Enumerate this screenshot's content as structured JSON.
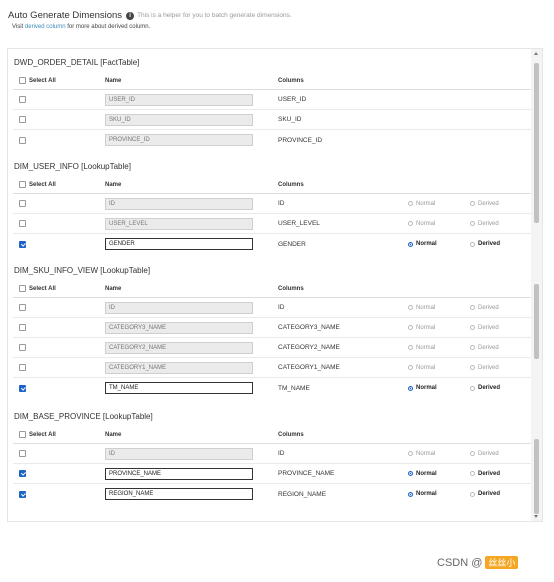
{
  "header": {
    "title": "Auto Generate Dimensions",
    "info_icon": "info-circle-icon",
    "helper": "This is a helper for you to batch generate dimensions.",
    "visit_prefix": "Visit",
    "link_text": "derived column",
    "visit_suffix": "for more about derived column."
  },
  "columns_header": {
    "select_all": "Select All",
    "name": "Name",
    "columns": "Columns"
  },
  "sections": [
    {
      "title": "DWD_ORDER_DETAIL [FactTable]",
      "rows": [
        {
          "checked": false,
          "name": "USER_ID",
          "column": "USER_ID",
          "editable": true
        },
        {
          "checked": false,
          "name": "SKU_ID",
          "column": "SKU_ID",
          "editable": false
        },
        {
          "checked": false,
          "name": "PROVINCE_ID",
          "column": "PROVINCE_ID",
          "editable": true
        }
      ]
    },
    {
      "title": "DIM_USER_INFO [LookupTable]",
      "rows": [
        {
          "checked": false,
          "name": "ID",
          "column": "ID",
          "editable": false,
          "normal": "Normal",
          "derived": "Derived",
          "type": "none"
        },
        {
          "checked": false,
          "name": "USER_LEVEL",
          "column": "USER_LEVEL",
          "editable": false,
          "normal": "Normal",
          "derived": "Derived",
          "type": "none"
        },
        {
          "checked": true,
          "name": "GENDER",
          "column": "GENDER",
          "editable": true,
          "normal": "Normal",
          "derived": "Derived",
          "type": "normal"
        }
      ]
    },
    {
      "title": "DIM_SKU_INFO_VIEW [LookupTable]",
      "rows": [
        {
          "checked": false,
          "name": "ID",
          "column": "ID",
          "editable": false,
          "normal": "Normal",
          "derived": "Derived",
          "type": "none"
        },
        {
          "checked": false,
          "name": "CATEGORY3_NAME",
          "column": "CATEGORY3_NAME",
          "editable": false,
          "normal": "Normal",
          "derived": "Derived",
          "type": "none"
        },
        {
          "checked": false,
          "name": "CATEGORY2_NAME",
          "column": "CATEGORY2_NAME",
          "editable": false,
          "normal": "Normal",
          "derived": "Derived",
          "type": "none"
        },
        {
          "checked": false,
          "name": "CATEGORY1_NAME",
          "column": "CATEGORY1_NAME",
          "editable": false,
          "normal": "Normal",
          "derived": "Derived",
          "type": "none"
        },
        {
          "checked": true,
          "name": "TM_NAME",
          "column": "TM_NAME",
          "editable": true,
          "normal": "Normal",
          "derived": "Derived",
          "type": "normal"
        }
      ]
    },
    {
      "title": "DIM_BASE_PROVINCE [LookupTable]",
      "rows": [
        {
          "checked": false,
          "name": "ID",
          "column": "ID",
          "editable": false,
          "normal": "Normal",
          "derived": "Derived",
          "type": "none"
        },
        {
          "checked": true,
          "name": "PROVINCE_NAME",
          "column": "PROVINCE_NAME",
          "editable": true,
          "normal": "Normal",
          "derived": "Derived",
          "type": "normal"
        },
        {
          "checked": true,
          "name": "REGION_NAME",
          "column": "REGION_NAME",
          "editable": true,
          "normal": "Normal",
          "derived": "Derived",
          "type": "normal"
        }
      ]
    }
  ],
  "watermark": {
    "text": "CSDN @",
    "badge": "丝丝小"
  }
}
